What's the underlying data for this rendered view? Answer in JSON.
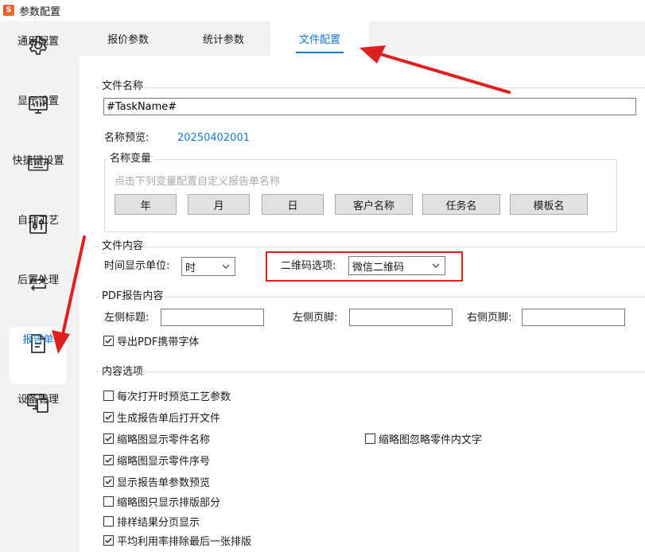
{
  "window": {
    "title": "参数配置"
  },
  "sidebar": {
    "items": [
      {
        "label": "通用配置",
        "icon": "gear-icon"
      },
      {
        "label": "显示设置",
        "icon": "monitor-chart-icon"
      },
      {
        "label": "快捷键设置",
        "icon": "keyboard-icon"
      },
      {
        "label": "自动工艺",
        "icon": "sliders-icon"
      },
      {
        "label": "后置处理",
        "icon": "repeat-icon"
      },
      {
        "label": "报告单",
        "icon": "document-icon",
        "active": true
      },
      {
        "label": "设备管理",
        "icon": "devices-icon"
      }
    ]
  },
  "tabs": [
    {
      "label": "报价参数"
    },
    {
      "label": "统计参数"
    },
    {
      "label": "文件配置",
      "active": true
    }
  ],
  "file_name": {
    "title": "文件名称",
    "input_value": "#TaskName#",
    "preview_label": "名称预览:",
    "preview_value": "20250402001",
    "variables": {
      "title": "名称变量",
      "hint": "点击下列变量配置自定义报告单名称",
      "buttons": [
        "年",
        "月",
        "日",
        "客户名称",
        "任务名",
        "模板名"
      ]
    }
  },
  "file_content": {
    "title": "文件内容",
    "time_unit_label": "时间显示单位:",
    "time_unit_value": "时",
    "qr_label": "二维码选项:",
    "qr_value": "微信二维码"
  },
  "pdf": {
    "title": "PDF报告内容",
    "left_title_label": "左侧标题:",
    "left_title_value": "",
    "left_footer_label": "左侧页脚:",
    "left_footer_value": "",
    "right_footer_label": "右侧页脚:",
    "right_footer_value": "",
    "embed_font": {
      "label": "导出PDF携带字体",
      "checked": true
    }
  },
  "content_options": {
    "title": "内容选项",
    "items": [
      {
        "label": "每次打开时预览工艺参数",
        "checked": false
      },
      {
        "label": "生成报告单后打开文件",
        "checked": true
      },
      {
        "label": "缩略图显示零件名称",
        "checked": true
      },
      {
        "label": "缩略图忽略零件内文字",
        "checked": false
      },
      {
        "label": "缩略图显示零件序号",
        "checked": true
      },
      {
        "label": "显示报告单参数预览",
        "checked": true
      },
      {
        "label": "缩略图只显示排版部分",
        "checked": false
      },
      {
        "label": "排样结果分页显示",
        "checked": false
      },
      {
        "label": "平均利用率排除最后一张排版",
        "checked": true
      }
    ]
  },
  "colors": {
    "accent": "#1677d4",
    "annotation": "#e02020",
    "sidebar_bg": "#f2f2f2"
  }
}
